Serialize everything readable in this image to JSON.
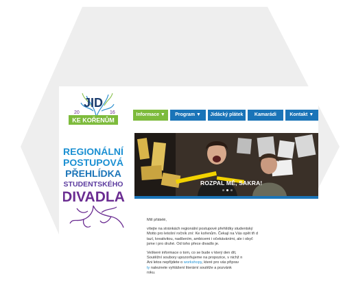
{
  "logo": {
    "acronym": "JID",
    "year_left": "20",
    "year_right": "16",
    "subtitle": "KE KOŘENŮM",
    "tagline": [
      "REGIONÁLNÍ",
      "POSTUPOVÁ",
      "PŘEHLÍDKA",
      "STUDENTSKÉHO",
      "DIVADLA"
    ]
  },
  "colors": {
    "accent_green": "#7dbb3c",
    "nav_blue": "#1a74b8",
    "tagline_blue": "#1a8fd2",
    "tagline_purple": "#6a2c91"
  },
  "nav": [
    {
      "label": "Informace ▼",
      "active": true
    },
    {
      "label": "Program ▼",
      "active": false
    },
    {
      "label": "Jidácký plátek",
      "active": false
    },
    {
      "label": "Kamarádi",
      "active": false
    },
    {
      "label": "Kontakt ▼",
      "active": false
    }
  ],
  "banner": {
    "caption": "ROZPAL MĚ, SAKRA!",
    "slides_total": 3,
    "active_slide": 2
  },
  "content": {
    "greeting": "Milí přátelé,",
    "para1": [
      "vítejte na stránkách regionální postupové přehlídky studentský",
      "Motto pro letošní ročník zní: Ke kořenům. Čekají na Vás opět tři d",
      "tazí, kreativitou, nadšením, ambicemi i očekáváními, ale i obyč",
      "jsme i pro druhé. Od toho přece divadlo je."
    ],
    "para2_line1": "Veškeré informace o tom, co se bude v který den dít,",
    "para2_line2": "Soutěžní soubory upozorňujeme na propozice, v nichž n",
    "para2_line3_pre": "Ani letos nepřijdete o ",
    "para2_link": "workshopy",
    "para2_line3_post": ", které pro vás připrav",
    "para2_line4_link": "ty",
    "para2_line4_post": " naleznete vyhlášení literární soutěže a pozvánk",
    "para2_line5": "roku."
  }
}
